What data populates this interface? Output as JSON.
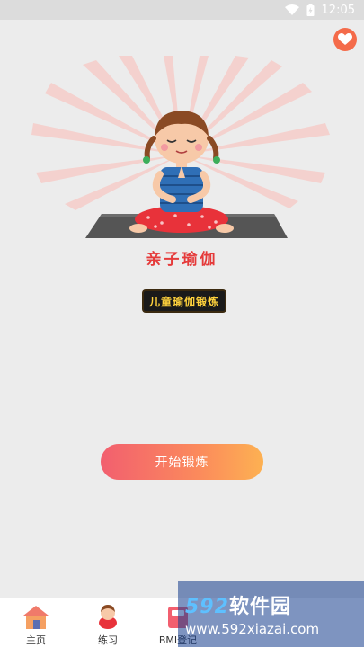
{
  "status_bar": {
    "time": "12:05"
  },
  "app": {
    "title": "亲子瑜伽",
    "badge": "儿童瑜伽锻炼"
  },
  "actions": {
    "start_label": "开始锻炼"
  },
  "tabs": [
    {
      "label": "主页",
      "icon": "home-icon"
    },
    {
      "label": "练习",
      "icon": "exercise-icon"
    },
    {
      "label": "BMI登记",
      "icon": "bmi-icon"
    }
  ],
  "watermark": {
    "number": "592",
    "site_name": "软件园",
    "url": "www.592xiazai.com"
  },
  "colors": {
    "accent": "#e53a3a",
    "button_start": "#f25f6f",
    "button_end": "#fdb152",
    "heart": "#f46b4a"
  }
}
